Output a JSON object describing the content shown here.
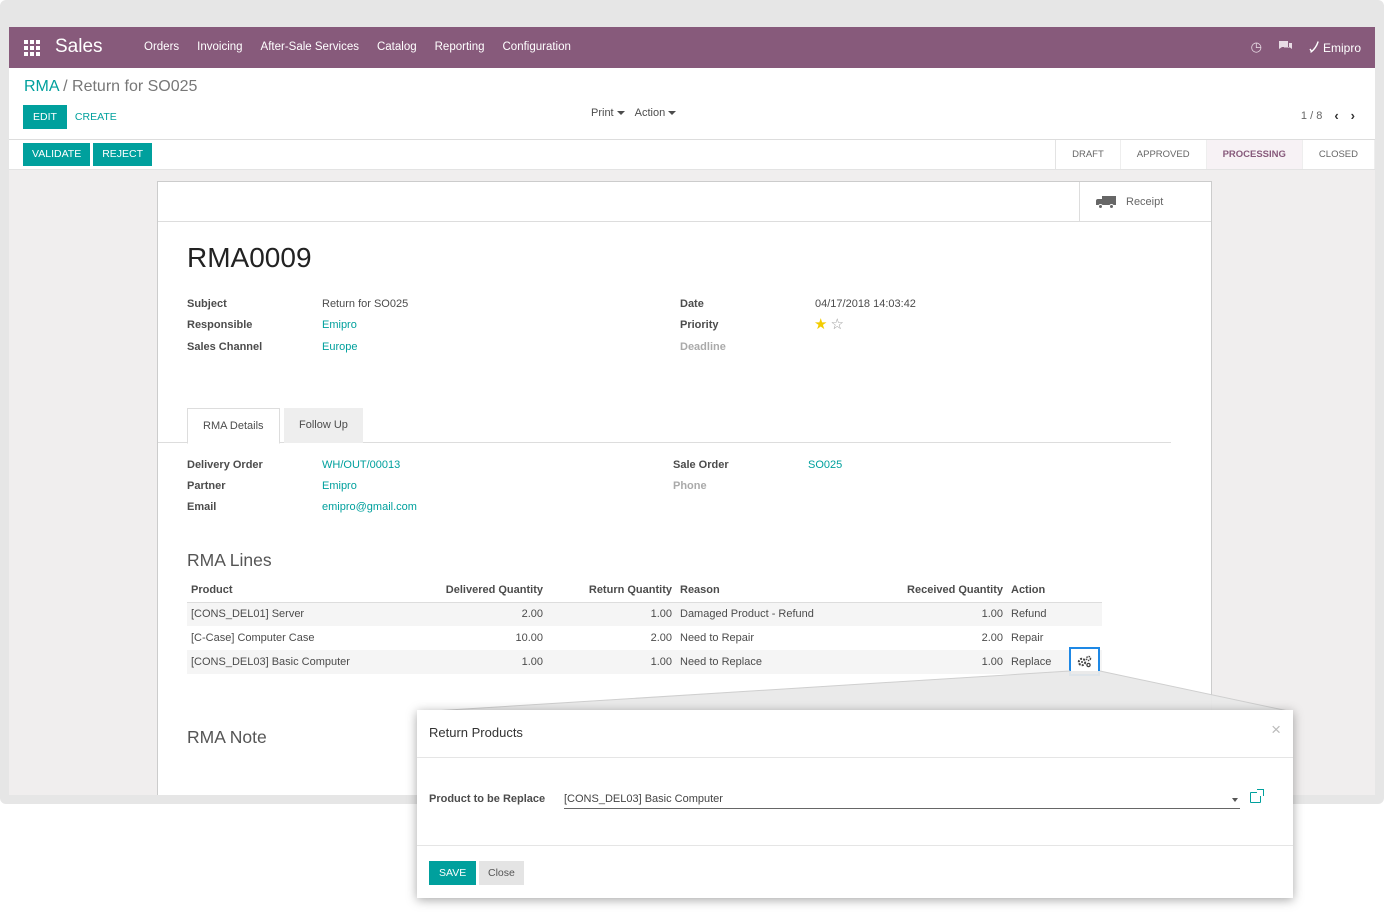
{
  "navbar": {
    "brand": "Sales",
    "menu": [
      "Orders",
      "Invoicing",
      "After-Sale Services",
      "Catalog",
      "Reporting",
      "Configuration"
    ],
    "user": "Emipro",
    "icons": [
      "apps-grid-icon",
      "clock-icon",
      "chat-icon",
      "phone-icon"
    ]
  },
  "breadcrumb": {
    "parent": "RMA",
    "separator": "/",
    "current": "Return for SO025"
  },
  "control": {
    "edit": "Edit",
    "create": "Create",
    "print": "Print",
    "action": "Action",
    "pager": "1 / 8"
  },
  "statusbar": {
    "validate": "Validate",
    "reject": "Reject",
    "stages": [
      "Draft",
      "Approved",
      "Processing",
      "Closed"
    ],
    "active_stage": "Processing"
  },
  "button_box": {
    "receipt": "Receipt"
  },
  "record": {
    "name": "RMA0009",
    "fields_left": [
      {
        "label": "Subject",
        "value": "Return for SO025"
      },
      {
        "label": "Responsible",
        "value": "Emipro"
      },
      {
        "label": "Sales Channel",
        "value": "Europe"
      }
    ],
    "fields_right": [
      {
        "label": "Date",
        "value": "04/17/2018 14:03:42"
      },
      {
        "label": "Priority",
        "value": ""
      },
      {
        "label": "Deadline",
        "value": ""
      }
    ],
    "priority": {
      "stars_filled": 1,
      "stars_total": 2
    }
  },
  "tabs": [
    "RMA Details",
    "Follow Up"
  ],
  "details": {
    "left": [
      {
        "label": "Delivery Order",
        "value": "WH/OUT/00013"
      },
      {
        "label": "Partner",
        "value": "Emipro"
      },
      {
        "label": "Email",
        "value": "emipro@gmail.com"
      }
    ],
    "right": [
      {
        "label": "Sale Order",
        "value": "SO025"
      },
      {
        "label": "Phone",
        "value": ""
      }
    ]
  },
  "rma_lines": {
    "title": "RMA Lines",
    "columns": [
      "Product",
      "Delivered Quantity",
      "Return Quantity",
      "Reason",
      "Received Quantity",
      "Action"
    ],
    "rows": [
      [
        "[CONS_DEL01] Server",
        "2.00",
        "1.00",
        "Damaged Product - Refund",
        "1.00",
        "Refund"
      ],
      [
        "[C-Case] Computer Case",
        "10.00",
        "2.00",
        "Need to Repair",
        "2.00",
        "Repair"
      ],
      [
        "[CONS_DEL03] Basic Computer",
        "1.00",
        "1.00",
        "Need to Replace",
        "1.00",
        "Replace"
      ]
    ]
  },
  "rma_note": {
    "title": "RMA Note"
  },
  "dialog": {
    "title": "Return Products",
    "close_glyph": "×",
    "field_label": "Product to be Replace",
    "field_value": "[CONS_DEL03] Basic Computer",
    "save": "Save",
    "close": "Close"
  },
  "colors": {
    "brand": "#875a7b",
    "primary": "#00a09d",
    "highlight": "#1e88e5",
    "star": "#f3cc00"
  }
}
